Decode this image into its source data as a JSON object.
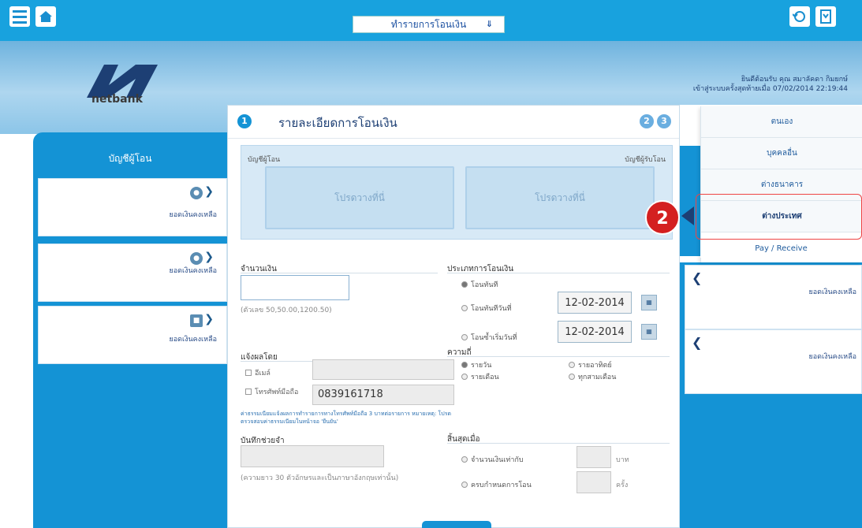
{
  "topbar": {
    "menu_icon": "hamburger-icon",
    "home_icon": "home-icon",
    "select_value": "ทำรายการโอนเงิน",
    "refresh_icon": "logout-icon",
    "bookmark_icon": "bookmark-icon"
  },
  "banner": {
    "logo_text": "netbank",
    "welcome_line": "ยินดีต้อนรับ คุณ สมาลัคดา กิมยกษ์",
    "last_login": "เข้าสู่ระบบครั้งสุดท้ายเมื่อ 07/02/2014 22:19:44"
  },
  "left_panel": {
    "title": "บัญชีผู้โอน",
    "accounts": [
      {
        "label": "ยอดเงินคงเหลือ"
      },
      {
        "label": "ยอดเงินคงเหลือ"
      },
      {
        "label": "ยอดเงินคงเหลือ"
      }
    ]
  },
  "center": {
    "step": "1",
    "title": "รายละเอียดการโอนเงิน",
    "steps_next": [
      "2",
      "3"
    ],
    "from_label": "บัญชีผู้โอน",
    "to_label": "บัญชีผู้รับโอน",
    "drop_text_left": "โปรดวางที่นี่",
    "drop_text_right": "โปรดวางที่นี่",
    "amount_label": "จำนวนเงิน",
    "amount_hint": "(ตัวเลข 50,50.00,1200.50)",
    "transfer_type_label": "ประเภทการโอนเงิน",
    "transfer_types": [
      "โอนทันที",
      "โอนทันทีวันที่",
      "โอนซ้ำเริ่มวันที่"
    ],
    "date1": "12-02-2014",
    "date2": "12-02-2014",
    "notify_label": "แจ้งผลโดย",
    "notify_email": "อีเมล์",
    "notify_phone": "โทรศัพท์มือถือ",
    "phone_value": "0839161718",
    "notice_text": "ค่าธรรมเนียมแจ้งผลการทำรายการทางโทรศัพท์มือถือ 3 บาทต่อรายการ หมายเหตุ: โปรดตรวจสอบค่าธรรมเนียมในหน้าจอ 'ยืนยัน'",
    "memo_label": "บันทึกช่วยจำ",
    "memo_hint": "(ความยาว 30 ตัวอักษรและเป็นภาษาอังกฤษเท่านั้น)",
    "frequency_label": "ความถี่",
    "frequencies": [
      "รายวัน",
      "รายอาทิตย์",
      "รายเดือน",
      "ทุกสามเดือน"
    ],
    "end_label": "สิ้นสุดเมื่อ",
    "end_options": [
      "จำนวนเงินเท่ากับ",
      "ครบกำหนดการโอน"
    ],
    "end_units": [
      "บาท",
      "ครั้ง"
    ]
  },
  "right_panel": {
    "items": [
      "ตนเอง",
      "บุคคลอื่น",
      "ต่างธนาคาร",
      "ต่างประเทศ"
    ],
    "pay_receive": "Pay / Receive",
    "cards": [
      {
        "label": "ยอดเงินคงเหลือ"
      },
      {
        "label": "ยอดเงินคงเหลือ"
      }
    ]
  },
  "annotation": {
    "badge": "2"
  },
  "colors": {
    "primary": "#1493d5",
    "accent_red": "#d42020"
  }
}
